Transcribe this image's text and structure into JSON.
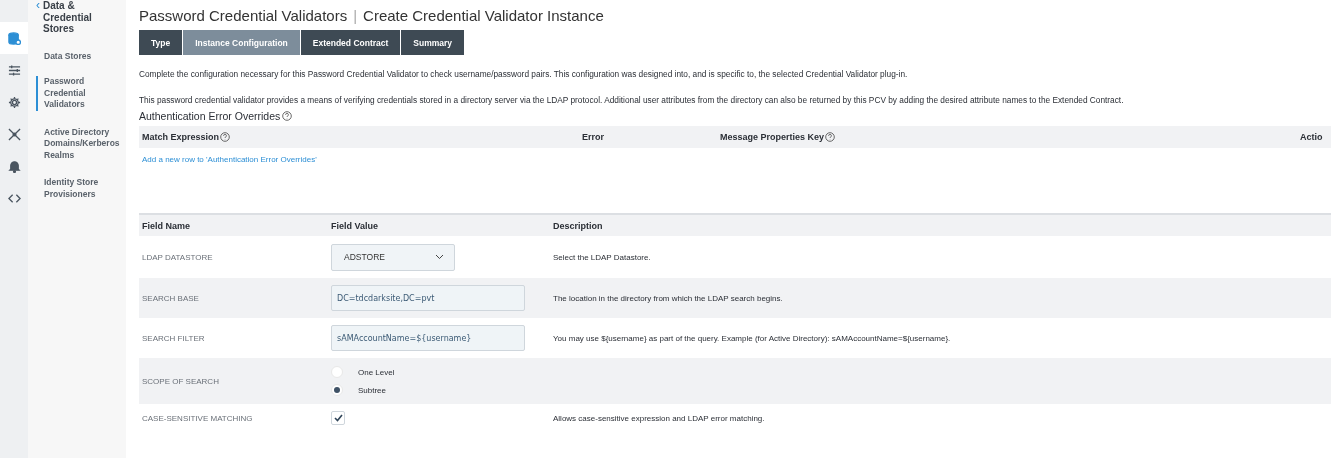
{
  "icon_rail": [
    {
      "kind": "database",
      "selected": true
    },
    {
      "kind": "sliders",
      "selected": false
    },
    {
      "kind": "gear",
      "selected": false
    },
    {
      "kind": "network",
      "selected": false
    },
    {
      "kind": "bell",
      "selected": false
    },
    {
      "kind": "code",
      "selected": false
    }
  ],
  "nav": {
    "back": "‹",
    "title": "Data & Credential Stores",
    "items": [
      {
        "label": "Data Stores",
        "selected": false
      },
      {
        "label": "Password Credential Validators",
        "selected": true
      },
      {
        "label": "Active Directory Domains/Kerberos Realms",
        "selected": false
      },
      {
        "label": "Identity Store Provisioners",
        "selected": false
      }
    ]
  },
  "page": {
    "title": "Password Credential Validators",
    "separator": "|",
    "subtitle": "Create Credential Validator Instance"
  },
  "tabs": [
    {
      "label": "Type",
      "selected": false
    },
    {
      "label": "Instance Configuration",
      "selected": true
    },
    {
      "label": "Extended Contract",
      "selected": false
    },
    {
      "label": "Summary",
      "selected": false
    }
  ],
  "intro": [
    "Complete the configuration necessary for this Password Credential Validator to check username/password pairs. This configuration was designed into, and is specific to, the selected Credential Validator plug-in.",
    "This password credential validator provides a means of verifying credentials stored in a directory server via the LDAP protocol. Additional user attributes from the directory can also be returned by this PCV by adding the desired attribute names to the Extended Contract."
  ],
  "overrides": {
    "title": "Authentication Error Overrides",
    "columns": [
      {
        "label": "Match Expression",
        "help": true
      },
      {
        "label": "Error",
        "help": false
      },
      {
        "label": "Message Properties Key",
        "help": true
      },
      {
        "label": "Actio",
        "help": false
      }
    ],
    "add_link": "Add a new row to 'Authentication Error Overrides'"
  },
  "fields": {
    "columns": [
      "Field Name",
      "Field Value",
      "Description"
    ],
    "rows": [
      {
        "name": "LDAP DATASTORE",
        "kind": "select",
        "value": "ADSTORE",
        "description": "Select the LDAP Datastore."
      },
      {
        "name": "SEARCH BASE",
        "kind": "text",
        "value": "DC=tdcdarksite,DC=pvt",
        "description": "The location in the directory from which the LDAP search begins."
      },
      {
        "name": "SEARCH FILTER",
        "kind": "text",
        "value": "sAMAccountName=${username}",
        "description": "You may use ${username} as part of the query. Example (for Active Directory): sAMAccountName=${username}."
      },
      {
        "name": "SCOPE OF SEARCH",
        "kind": "radio",
        "options": [
          {
            "label": "One Level",
            "selected": false
          },
          {
            "label": "Subtree",
            "selected": true
          }
        ]
      },
      {
        "name": "CASE-SENSITIVE MATCHING",
        "kind": "checkbox",
        "checked": true,
        "description": "Allows case-sensitive expression and LDAP error matching."
      }
    ]
  }
}
